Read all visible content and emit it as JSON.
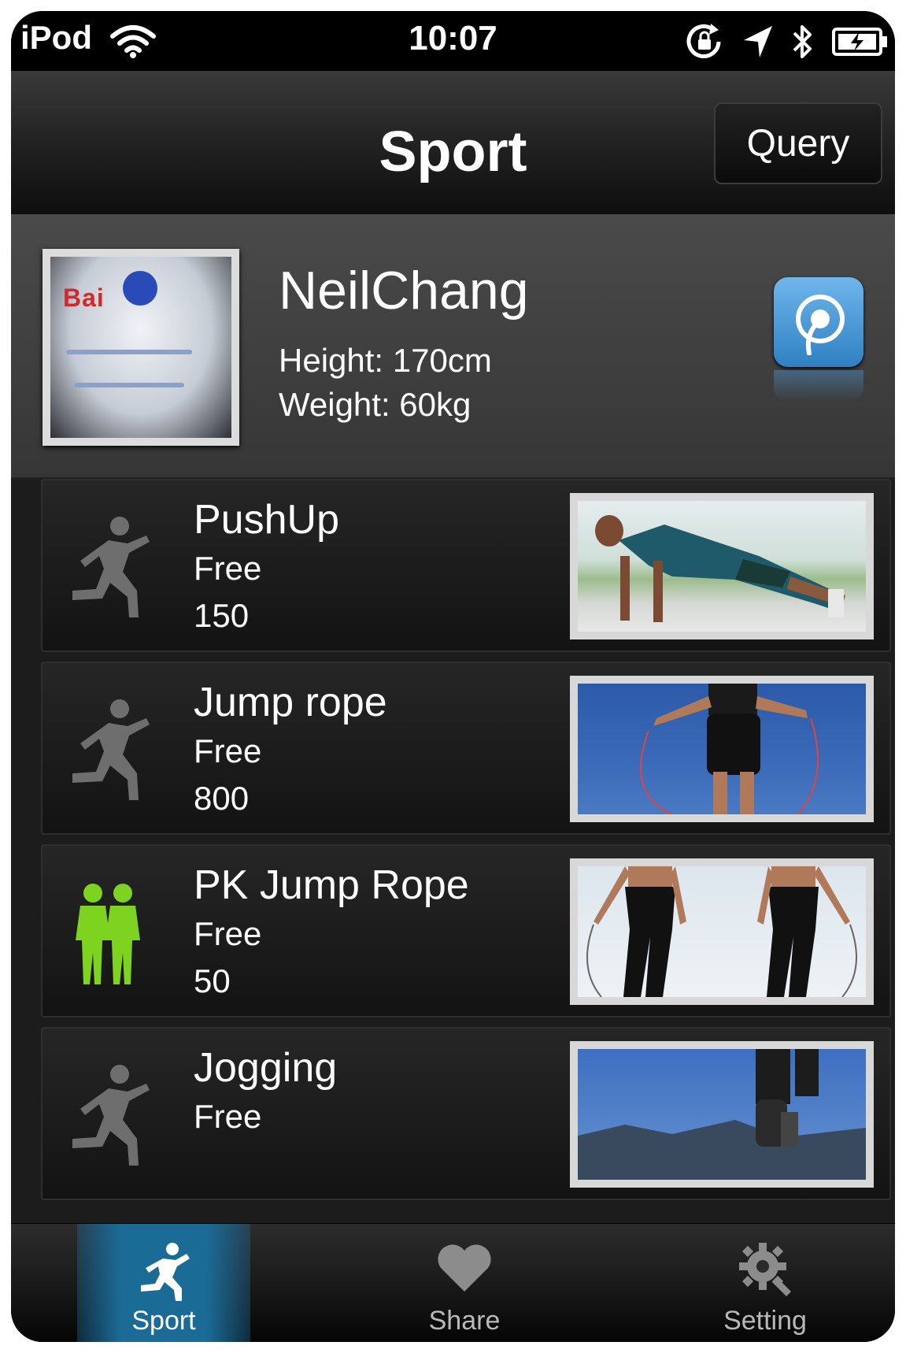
{
  "status_bar": {
    "carrier": "iPod",
    "time": "10:07",
    "icons": [
      "wifi-icon",
      "rotation-lock-icon",
      "location-arrow-icon",
      "bluetooth-icon",
      "battery-charging-icon"
    ]
  },
  "nav": {
    "title": "Sport",
    "query_label": "Query"
  },
  "profile": {
    "name": "NeilChang",
    "height": "Height: 170cm",
    "weight": "Weight: 60kg",
    "avatar_logo_text": "Bai",
    "sync_icon": "sync-icon"
  },
  "sports": [
    {
      "title": "PushUp",
      "mode": "Free",
      "count": "150",
      "icon": "running-person-icon"
    },
    {
      "title": "Jump rope",
      "mode": "Free",
      "count": "800",
      "icon": "running-person-icon"
    },
    {
      "title": "PK Jump Rope",
      "mode": "Free",
      "count": "50",
      "icon": "two-persons-icon"
    },
    {
      "title": "Jogging",
      "mode": "Free",
      "count": "",
      "icon": "running-person-icon"
    }
  ],
  "tabs": [
    {
      "label": "Sport",
      "icon": "runner-icon",
      "active": true
    },
    {
      "label": "Share",
      "icon": "heart-icon",
      "active": false
    },
    {
      "label": "Setting",
      "icon": "gear-icon",
      "active": false
    }
  ],
  "colors": {
    "active_tab": "#1a6b96",
    "pk_icon": "#7ed321",
    "sync_button": "#3f8fd0",
    "runner_icon_gray": "#6e6e6e"
  }
}
